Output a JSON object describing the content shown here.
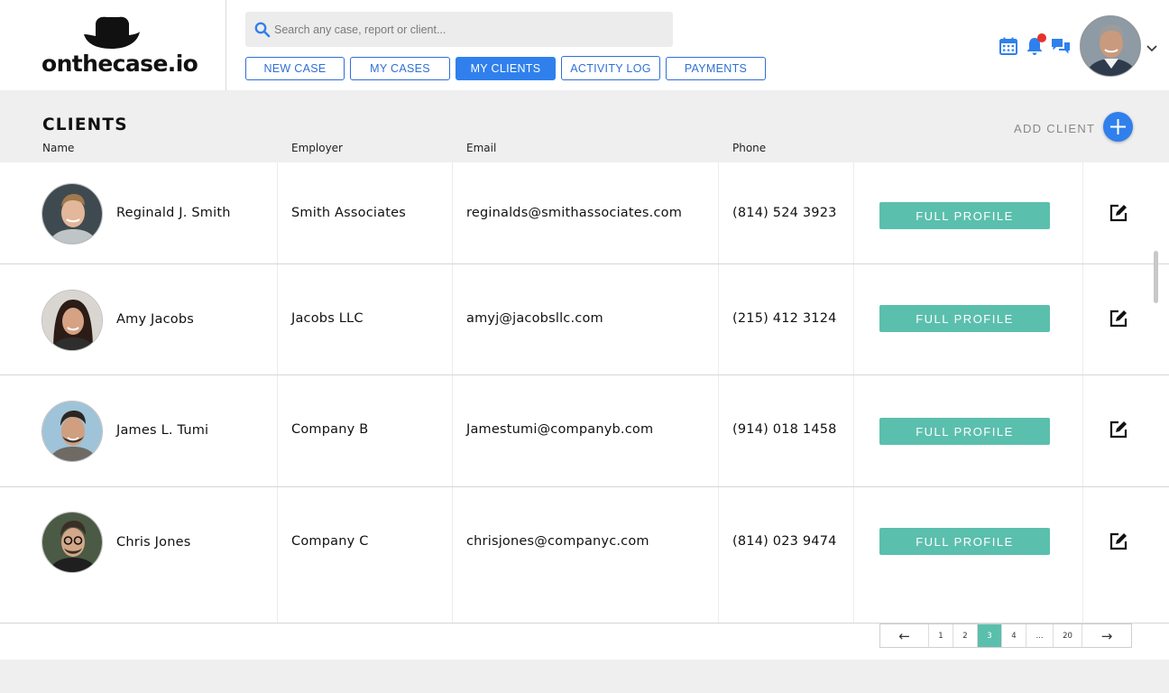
{
  "brand": {
    "logo_text": "onthecase.io"
  },
  "search": {
    "placeholder": "Search any case, report or client..."
  },
  "nav": {
    "new_case": "NEW CASE",
    "my_cases": "MY CASES",
    "my_clients": "MY CLIENTS",
    "activity_log": "ACTIVITY LOG",
    "payments": "PAYMENTS",
    "active": "MY CLIENTS"
  },
  "header_icons": [
    "calendar-icon",
    "bell-icon",
    "chat-icon",
    "chevron-down-icon"
  ],
  "page": {
    "title": "CLIENTS",
    "add_client_label": "ADD CLIENT"
  },
  "table": {
    "columns": [
      "Name",
      "Employer",
      "Email",
      "Phone"
    ],
    "rows": [
      {
        "name": "Reginald J. Smith",
        "employer": "Smith Associates",
        "email": "reginalds@smithassociates.com",
        "phone": "(814) 524 3923",
        "action": "FULL PROFILE"
      },
      {
        "name": "Amy Jacobs",
        "employer": "Jacobs LLC",
        "email": "amyj@jacobsllc.com",
        "phone": "(215) 412 3124",
        "action": "FULL PROFILE"
      },
      {
        "name": "James L. Tumi",
        "employer": "Company B",
        "email": "Jamestumi@companyb.com",
        "phone": "(914) 018 1458",
        "action": "FULL PROFILE"
      },
      {
        "name": "Chris Jones",
        "employer": "Company C",
        "email": "chrisjones@companyc.com",
        "phone": "(814) 023 9474",
        "action": "FULL PROFILE"
      }
    ]
  },
  "pagination": {
    "prev": "←",
    "pages": [
      "1",
      "2",
      "3",
      "4",
      "...",
      "20"
    ],
    "current": "3",
    "next": "→"
  },
  "colors": {
    "primary": "#2f80ed",
    "teal": "#5bbfad",
    "notification": "#e5322d",
    "band": "#efefef"
  }
}
